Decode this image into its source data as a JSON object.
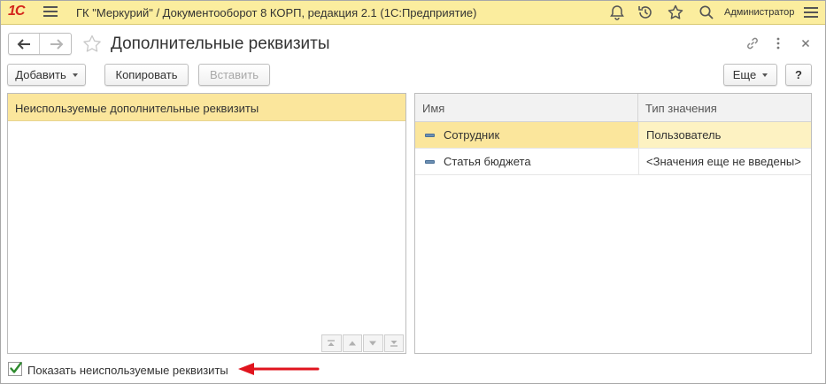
{
  "titlebar": {
    "logo": "1С",
    "title": "ГК \"Меркурий\" / Документооборот 8 КОРП, редакция 2.1  (1С:Предприятие)",
    "user": "Администратор"
  },
  "form": {
    "title": "Дополнительные реквизиты"
  },
  "toolbar": {
    "add_label": "Добавить",
    "copy_label": "Копировать",
    "paste_label": "Вставить",
    "more_label": "Еще",
    "help_label": "?"
  },
  "left_panel": {
    "items": [
      "Неиспользуемые дополнительные реквизиты"
    ]
  },
  "grid": {
    "columns": [
      "Имя",
      "Тип значения"
    ],
    "rows": [
      {
        "name": "Сотрудник",
        "type": "Пользователь"
      },
      {
        "name": "Статья бюджета",
        "type": "<Значения еще не введены>"
      }
    ]
  },
  "bottom": {
    "checkbox_label": "Показать неиспользуемые реквизиты",
    "checked": true
  },
  "colors": {
    "titlebar_bg": "#fbed9e",
    "selection": "#fbe69c",
    "annotation_arrow": "#e0141e",
    "checkmark": "#2e8b2e"
  }
}
